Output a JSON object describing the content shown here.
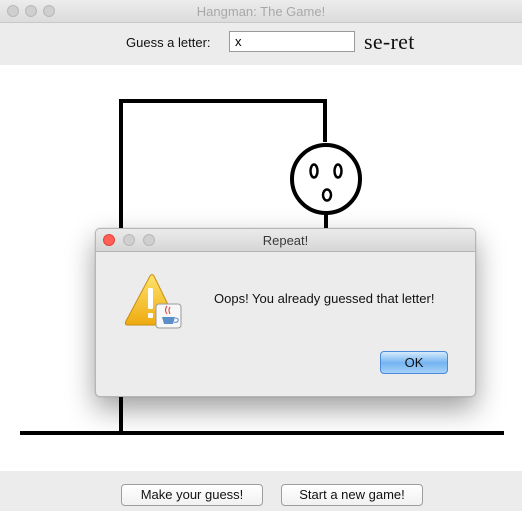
{
  "window": {
    "title": "Hangman: The Game!"
  },
  "guess": {
    "label": "Guess a letter:",
    "value": "x",
    "word": "se-ret"
  },
  "buttons": {
    "make_guess": "Make your guess!",
    "new_game": "Start a new game!"
  },
  "dialog": {
    "title": "Repeat!",
    "message": "Oops! You already guessed that letter!",
    "ok_label": "OK",
    "icon": "warning-icon"
  },
  "colors": {
    "close_button": "#ff5f57",
    "ok_accent": "#74b4f1",
    "warning": "#f5c518"
  }
}
